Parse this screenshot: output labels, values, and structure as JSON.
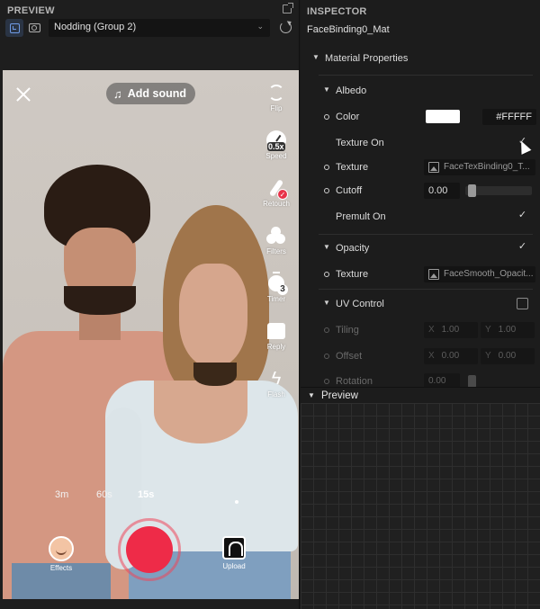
{
  "preview_panel": {
    "title": "PREVIEW",
    "selected_object": "Nodding (Group 2)",
    "viewport": {
      "add_sound_label": "Add sound",
      "side_tools": [
        {
          "label": "Flip",
          "icon": "flip-icon"
        },
        {
          "label": "Speed",
          "icon": "speed-icon",
          "badge": "0.5x"
        },
        {
          "label": "Retouch",
          "icon": "retouch-icon"
        },
        {
          "label": "Filters",
          "icon": "filters-icon"
        },
        {
          "label": "Timer",
          "icon": "timer-icon",
          "badge": "3"
        },
        {
          "label": "Reply",
          "icon": "reply-icon"
        },
        {
          "label": "Flash",
          "icon": "flash-icon"
        }
      ],
      "durations": [
        "3m",
        "60s",
        "15s"
      ],
      "active_duration": "15s",
      "effects_label": "Effects",
      "upload_label": "Upload",
      "record_color": "#ee2b48"
    }
  },
  "inspector": {
    "title": "INSPECTOR",
    "object_name": "FaceBinding0_Mat",
    "material_properties_label": "Material Properties",
    "albedo": {
      "section_label": "Albedo",
      "color_label": "Color",
      "color_value": "#FFFFF",
      "swatch_color": "#ffffff",
      "texture_on_label": "Texture On",
      "texture_on_checked": true,
      "texture_label": "Texture",
      "texture_value": "FaceTexBinding0_T...",
      "cutoff_label": "Cutoff",
      "cutoff_value": "0.00",
      "premult_on_label": "Premult On",
      "premult_on_checked": true
    },
    "opacity": {
      "section_label": "Opacity",
      "checked": true,
      "texture_label": "Texture",
      "texture_value": "FaceSmooth_Opacit..."
    },
    "uv_control": {
      "section_label": "UV Control",
      "checked": false,
      "tiling_label": "Tiling",
      "tiling_x": "1.00",
      "tiling_y": "1.00",
      "offset_label": "Offset",
      "offset_x": "0.00",
      "offset_y": "0.00",
      "rotation_label": "Rotation",
      "rotation_value": "0.00"
    }
  },
  "preview2": {
    "title": "Preview"
  }
}
